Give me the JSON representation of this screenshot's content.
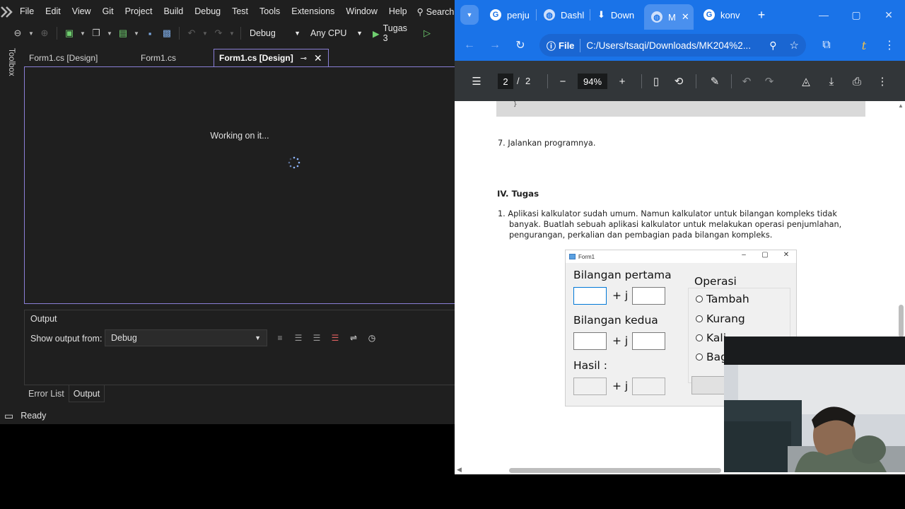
{
  "vs": {
    "menu": [
      "File",
      "Edit",
      "View",
      "Git",
      "Project",
      "Build",
      "Debug",
      "Test",
      "Tools",
      "Extensions",
      "Window",
      "Help"
    ],
    "search_label": "Search",
    "config_combo": "Debug",
    "platform_combo": "Any CPU",
    "run_label": "Tugas 3",
    "toolbox_label": "Toolbox",
    "doc_tabs": [
      "Form1.cs [Design]",
      "Form1.cs",
      "Form1.cs [Design]"
    ],
    "working_text": "Working on it...",
    "output": {
      "title": "Output",
      "show_from_label": "Show output from:",
      "source": "Debug"
    },
    "bottom_tabs": [
      "Error List",
      "Output"
    ],
    "status": "Ready"
  },
  "chrome": {
    "tabs": [
      "penju",
      "Dashl",
      "Down",
      "M",
      "konv"
    ],
    "url_chip": "File",
    "url": "C:/Users/tsaqi/Downloads/MK204%2...",
    "pdf": {
      "page_current": "2",
      "page_sep": "/",
      "page_total": "2",
      "zoom": "94%"
    }
  },
  "document": {
    "step7": "7.  Jalankan programnya.",
    "section_heading": "IV. Tugas",
    "task_line1": "1.  Aplikasi kalkulator sudah umum. Namun kalkulator untuk bilangan kompleks tidak",
    "task_line2": "banyak. Buatlah sebuah aplikasi kalkulator untuk melakukan operasi penjumlahan,",
    "task_line3": "pengurangan, perkalian dan pembagian pada bilangan kompleks.",
    "form": {
      "title": "Form1",
      "label_first": "Bilangan pertama",
      "label_second": "Bilangan kedua",
      "label_result": "Hasil :",
      "plus_j": "+ j",
      "group_title": "Operasi",
      "ops": [
        "Tambah",
        "Kurang",
        "Kali",
        "Bagi"
      ]
    }
  },
  "colors": {
    "vs_bg": "#1f1f1f",
    "vs_accent": "#8a7fd6",
    "chrome_blue": "#1a73e8",
    "pdf_toolbar": "#323639"
  }
}
